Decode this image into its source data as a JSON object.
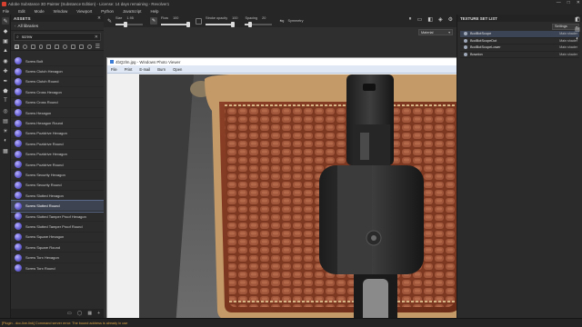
{
  "window": {
    "title": "Adobe Substance 3D Painter (Substance Edition) - License: 14 days remaining - Revolver1",
    "controls": [
      "—",
      "□",
      "✕"
    ]
  },
  "menu": [
    "File",
    "Edit",
    "Mode",
    "Window",
    "Viewport",
    "Python",
    "JavaScript",
    "Help"
  ],
  "tools": [
    {
      "name": "paint-brush-icon",
      "glyph": "✎",
      "active": true
    },
    {
      "name": "eraser-icon",
      "glyph": "◆",
      "active": false
    },
    {
      "name": "projection-icon",
      "glyph": "▣",
      "active": false
    },
    {
      "name": "geometry-fill-icon",
      "glyph": "▲",
      "active": false
    },
    {
      "name": "smudge-icon",
      "glyph": "◉",
      "active": false
    },
    {
      "name": "clone-icon",
      "glyph": "✚",
      "active": false
    },
    {
      "name": "material-picker-icon",
      "glyph": "✒",
      "active": false
    },
    {
      "name": "polygon-fill-icon",
      "glyph": "⬟",
      "active": false
    },
    {
      "name": "text-tool-icon",
      "glyph": "T",
      "active": false
    },
    {
      "name": "bake-icon",
      "glyph": "◎",
      "active": false
    },
    {
      "name": "library-icon",
      "glyph": "▤",
      "active": false
    },
    {
      "name": "display-settings-icon",
      "glyph": "☀",
      "active": false
    },
    {
      "name": "shader-settings-icon",
      "glyph": "◐",
      "active": false
    },
    {
      "name": "log-icon",
      "glyph": "▦",
      "active": false
    }
  ],
  "assets": {
    "title": "ASSETS",
    "breadcrumb": "All libraries",
    "search_value": "screw",
    "items": [
      {
        "label": "Screw Bolt",
        "selected": false
      },
      {
        "label": "Screw Clutch Hexagon",
        "selected": false
      },
      {
        "label": "Screw Clutch Round",
        "selected": false
      },
      {
        "label": "Screw Cross Hexagon",
        "selected": false
      },
      {
        "label": "Screw Cross Round",
        "selected": false
      },
      {
        "label": "Screw Hexagon",
        "selected": false
      },
      {
        "label": "Screw Hexagon Round",
        "selected": false
      },
      {
        "label": "Screw Pozidrive Hexagon",
        "selected": false
      },
      {
        "label": "Screw Pozidrive Round",
        "selected": false
      },
      {
        "label": "Screw Pozidrive Hexagon",
        "selected": false
      },
      {
        "label": "Screw Pozidrive Round",
        "selected": false
      },
      {
        "label": "Screw Security Hexagon",
        "selected": false
      },
      {
        "label": "Screw Security Round",
        "selected": false
      },
      {
        "label": "Screw Slotted Hexagon",
        "selected": false
      },
      {
        "label": "Screw Slotted Round",
        "selected": true
      },
      {
        "label": "Screw Slotted Tamper Proof Hexagon",
        "selected": false
      },
      {
        "label": "Screw Slotted Tamper Proof Round",
        "selected": false
      },
      {
        "label": "Screw Square Hexagon",
        "selected": false
      },
      {
        "label": "Screw Square Round",
        "selected": false
      },
      {
        "label": "Screw Torx Hexagon",
        "selected": false
      },
      {
        "label": "Screw Torx Round",
        "selected": false
      }
    ]
  },
  "context_toolbar": {
    "size_label": "Size",
    "size_value": "1.95",
    "size_fraction": 0.35,
    "flow_label": "Flow",
    "flow_value": "100",
    "flow_fraction": 1.0,
    "stroke_opacity_label": "Stroke opacity",
    "stroke_opacity_value": "100",
    "stroke_opacity_fraction": 1.0,
    "spacing_label": "Spacing",
    "spacing_value": "20",
    "spacing_fraction": 0.2,
    "symmetry_label": "Symmetry"
  },
  "viewport": {
    "mode_dropdown": "Material"
  },
  "photo_viewer": {
    "title": "4bQ2lm.jpg - Windows Photo Viewer",
    "menu": [
      "File",
      "Print",
      "E-mail",
      "Burn",
      "Open"
    ]
  },
  "texture_set_list": {
    "title": "TEXTURE SET LIST",
    "settings_label": "Settings",
    "rows": [
      {
        "name": "BodBotScope",
        "shader": "Main shader"
      },
      {
        "name": "BodBotScopeDot",
        "shader": "Main shader"
      },
      {
        "name": "BodBotScopeLower",
        "shader": "Main shader"
      },
      {
        "name": "Bowdon",
        "shader": "Main shader"
      }
    ]
  },
  "status": {
    "message": "[Plugin - dcc-live-link] Command server error: The bound address is already in use"
  },
  "colors": {
    "accent": "#5a6a8a",
    "panel_bg": "#2b2b2b",
    "status_warning": "#e0a64a"
  }
}
